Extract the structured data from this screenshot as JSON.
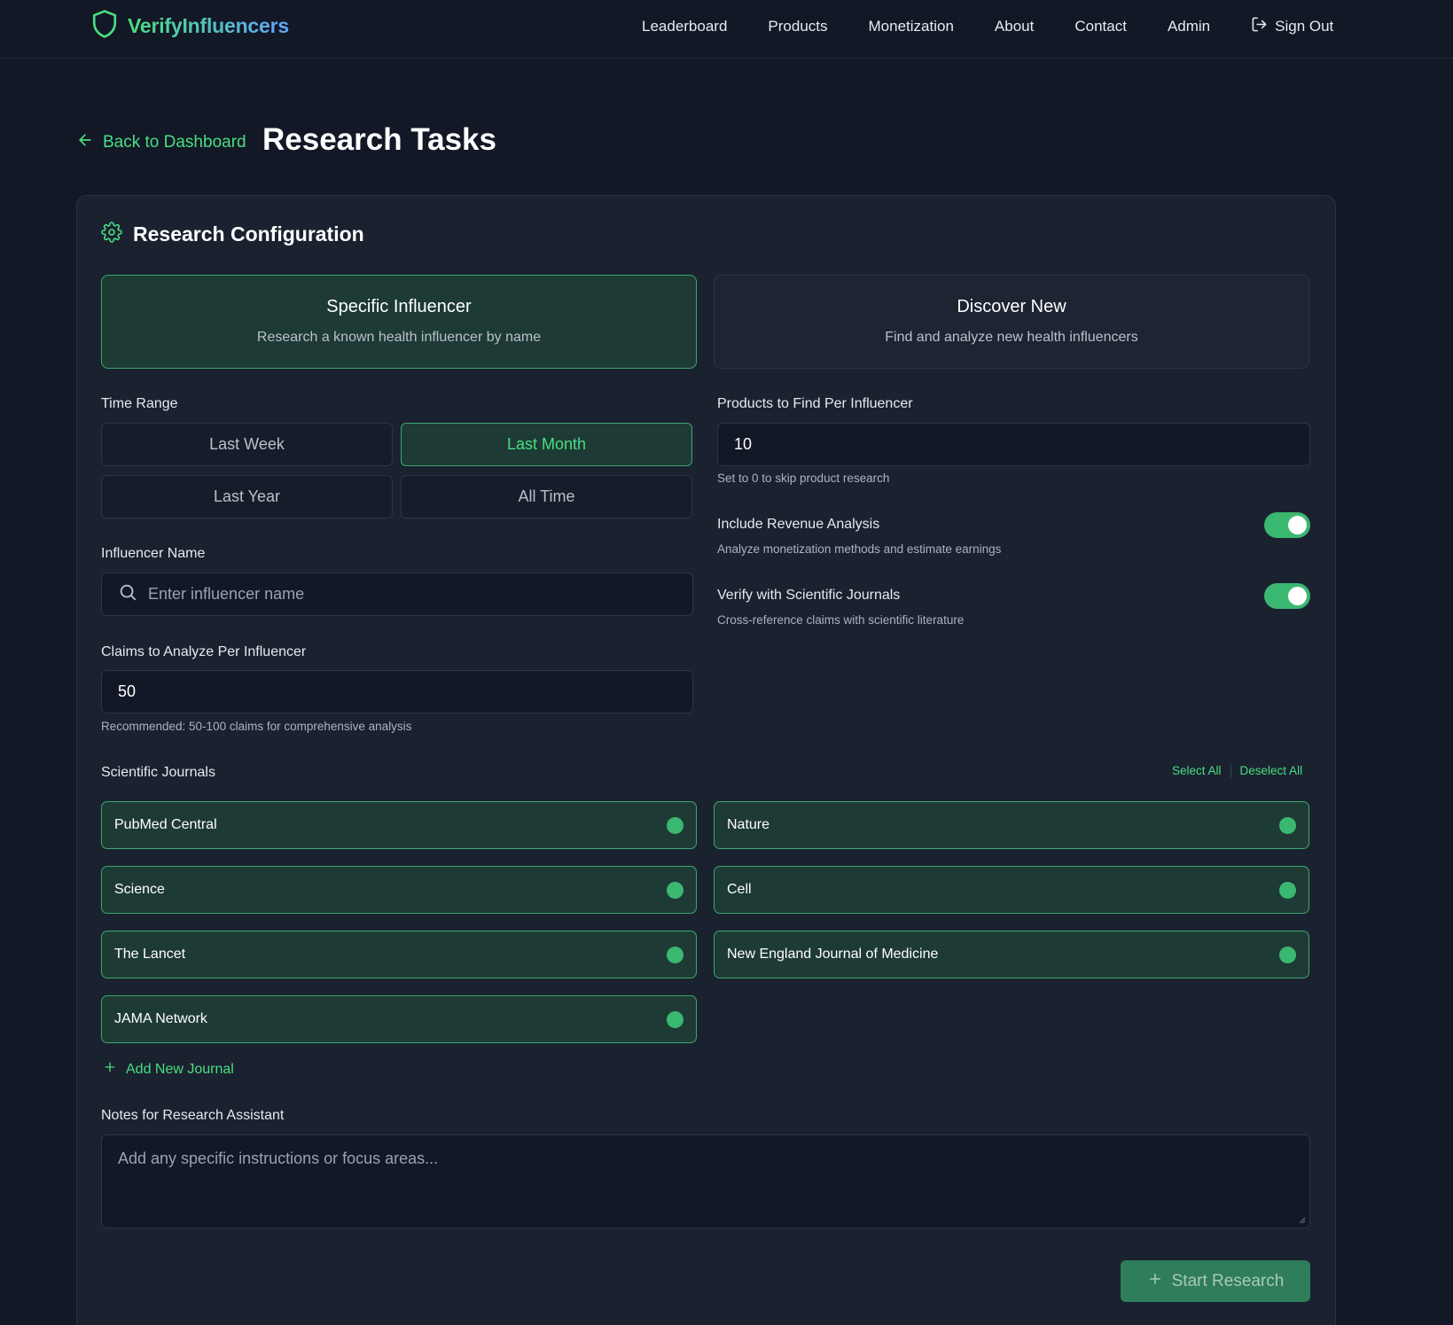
{
  "app": {
    "brand": "VerifyInfluencers"
  },
  "nav": {
    "items": [
      "Leaderboard",
      "Products",
      "Monetization",
      "About",
      "Contact",
      "Admin"
    ],
    "sign_out": "Sign Out"
  },
  "header": {
    "back_label": "Back to Dashboard",
    "title": "Research Tasks"
  },
  "config": {
    "title": "Research Configuration",
    "modes": [
      {
        "title": "Specific Influencer",
        "desc": "Research a known health influencer by name",
        "active": true
      },
      {
        "title": "Discover New",
        "desc": "Find and analyze new health influencers",
        "active": false
      }
    ],
    "time_range": {
      "label": "Time Range",
      "options": [
        "Last Week",
        "Last Month",
        "Last Year",
        "All Time"
      ],
      "selected": "Last Month"
    },
    "products": {
      "label": "Products to Find Per Influencer",
      "value": "10",
      "hint": "Set to 0 to skip product research"
    },
    "influencer": {
      "label": "Influencer Name",
      "placeholder": "Enter influencer name"
    },
    "claims": {
      "label": "Claims to Analyze Per Influencer",
      "value": "50",
      "hint": "Recommended: 50-100 claims for comprehensive analysis"
    },
    "toggles": [
      {
        "label": "Include Revenue Analysis",
        "desc": "Analyze monetization methods and estimate earnings",
        "on": true
      },
      {
        "label": "Verify with Scientific Journals",
        "desc": "Cross-reference claims with scientific literature",
        "on": true
      }
    ],
    "journals": {
      "label": "Scientific Journals",
      "select_all": "Select All",
      "deselect_all": "Deselect All",
      "items": [
        "PubMed Central",
        "Nature",
        "Science",
        "Cell",
        "The Lancet",
        "New England Journal of Medicine",
        "JAMA Network"
      ],
      "add_label": "Add New Journal"
    },
    "notes": {
      "label": "Notes for Research Assistant",
      "placeholder": "Add any specific instructions or focus areas..."
    },
    "start_label": "Start Research"
  },
  "colors": {
    "accent": "#4ade80",
    "background": "#121826",
    "card": "#1a2230",
    "selected_bg": "#1e3a35"
  }
}
